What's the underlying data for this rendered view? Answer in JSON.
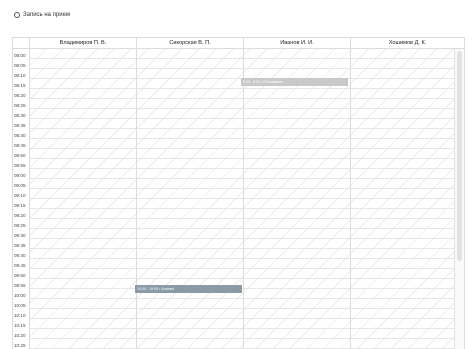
{
  "header": {
    "title": "Запись на прием",
    "icon": "clock-icon"
  },
  "doctors": [
    "Владимиров П. В.",
    "Сикорская В. П.",
    "Иванов И. И.",
    "Хошимов Д. К."
  ],
  "time_slots": [
    "08:00",
    "08:05",
    "08:10",
    "08:15",
    "08:20",
    "08:25",
    "08:30",
    "08:35",
    "08:40",
    "08:45",
    "08:50",
    "08:55",
    "09:00",
    "09:05",
    "09:10",
    "09:15",
    "09:20",
    "09:25",
    "09:30",
    "09:35",
    "09:40",
    "09:45",
    "09:50",
    "09:55",
    "10:00",
    "10:05",
    "10:10",
    "10:15",
    "10:20",
    "10:25",
    "10:30"
  ],
  "appointments": [
    {
      "doctor": "Иванов И. И.",
      "label": "8:15 - 8:20 • Пономарев",
      "color": "#c9c9c9"
    },
    {
      "doctor": "Сикорская В. П.",
      "label": "10:00 - 10:05 • Алиева",
      "color": "#8a9ba6"
    }
  ]
}
